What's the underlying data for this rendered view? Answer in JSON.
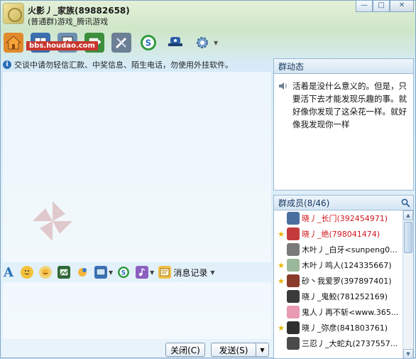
{
  "window": {
    "title": "火影丿_家族(89882658)",
    "subtitle": "(普通群)游戏_腾讯游戏",
    "watermark": "bbs.houdao.com"
  },
  "toolbar": {
    "icons": [
      "home-icon",
      "book-icon",
      "card-icon",
      "add-icon",
      "tools-icon",
      "money-icon",
      "hat-icon",
      "settings-icon"
    ]
  },
  "notice": {
    "text": "交谈中请勿轻信汇款、中奖信息、陌生电话，勿使用外挂软件。"
  },
  "chat_toolbar": {
    "font_label": "A",
    "msg_record_label": "消息记录"
  },
  "buttons": {
    "close": "关闭(C)",
    "send": "发送(S)"
  },
  "group_dynamic": {
    "header": "群动态",
    "text": "活着是没什么意义的。但是，只要活下去才能发现乐趣的事。就好像你发现了这朵花一样。就好像我发现你一样"
  },
  "members": {
    "header": "群成员(8/46)",
    "list": [
      {
        "name": "晓丿_长门(392454971)",
        "star": false,
        "red": true,
        "avatar_color": "#4a6f9e"
      },
      {
        "name": "晓丿_绝(798041474)",
        "star": true,
        "red": true,
        "avatar_color": "#c43b3b"
      },
      {
        "name": "木叶丿_白牙<sunpeng0...",
        "star": false,
        "red": false,
        "avatar_color": "#7a7a7a"
      },
      {
        "name": "木叶丿鸣人(124335667)",
        "star": true,
        "red": false,
        "avatar_color": "#9ab89a"
      },
      {
        "name": "砂丶我爱罗(397897401)",
        "star": true,
        "red": false,
        "avatar_color": "#8a3a2a"
      },
      {
        "name": "晓丿_鬼鲛(781252169)",
        "star": false,
        "red": false,
        "avatar_color": "#3a3a3a"
      },
      {
        "name": "鬼人丿再不斩<www.365...",
        "star": false,
        "red": false,
        "avatar_color": "#e79ab0"
      },
      {
        "name": "晓丿_弥彦(841803761)",
        "star": true,
        "red": false,
        "avatar_color": "#2f2f2f"
      },
      {
        "name": "三忍丿_大蛇丸(2737557...",
        "star": false,
        "red": false,
        "avatar_color": "#4b4b4b"
      }
    ]
  },
  "colors": {
    "accent": "#2d6fb8",
    "owner_red": "#d0161e",
    "admin_star": "#e8b400"
  }
}
